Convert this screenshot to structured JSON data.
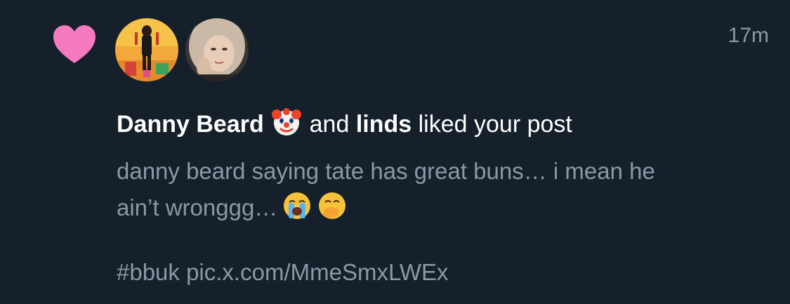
{
  "notification": {
    "timestamp": "17m",
    "user1": "Danny Beard",
    "and": "and",
    "user2": "linds",
    "action": "liked your post",
    "post_line1": "danny beard saying tate has great buns… i mean he",
    "post_line2": "ain’t wronggg…",
    "post_tags": "#bbuk pic.x.com/MmeSmxLWEx"
  },
  "colors": {
    "background": "#15202b",
    "heart": "#f57ac0",
    "secondary_text": "#8b98a5",
    "primary_text": "#ffffff"
  },
  "icons": {
    "like": "heart-icon",
    "user1_badge": "clown-emoji",
    "emoji1": "loudly-crying-emoji",
    "emoji2": "hand-over-mouth-emoji"
  }
}
